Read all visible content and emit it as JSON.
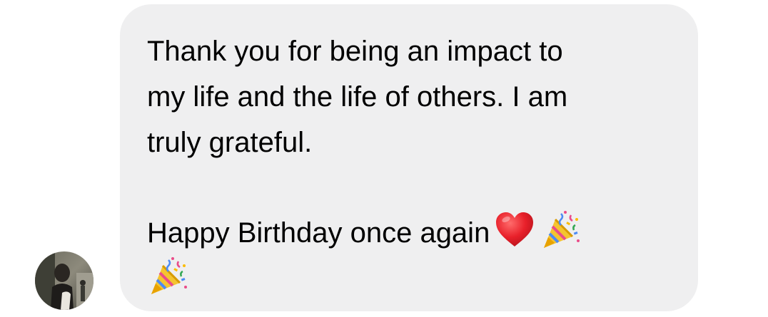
{
  "conversation": {
    "sender_avatar": {
      "icon": "person-photo-avatar"
    },
    "message": {
      "lines": [
        "Thank you for being an impact to",
        "my life and the life of others. I am",
        "truly grateful."
      ],
      "closing": "Happy Birthday once again",
      "emojis": [
        "red-heart-icon",
        "party-popper-icon",
        "party-popper-icon"
      ],
      "bubble_color": "#efeff0",
      "text_color": "#000000"
    }
  }
}
